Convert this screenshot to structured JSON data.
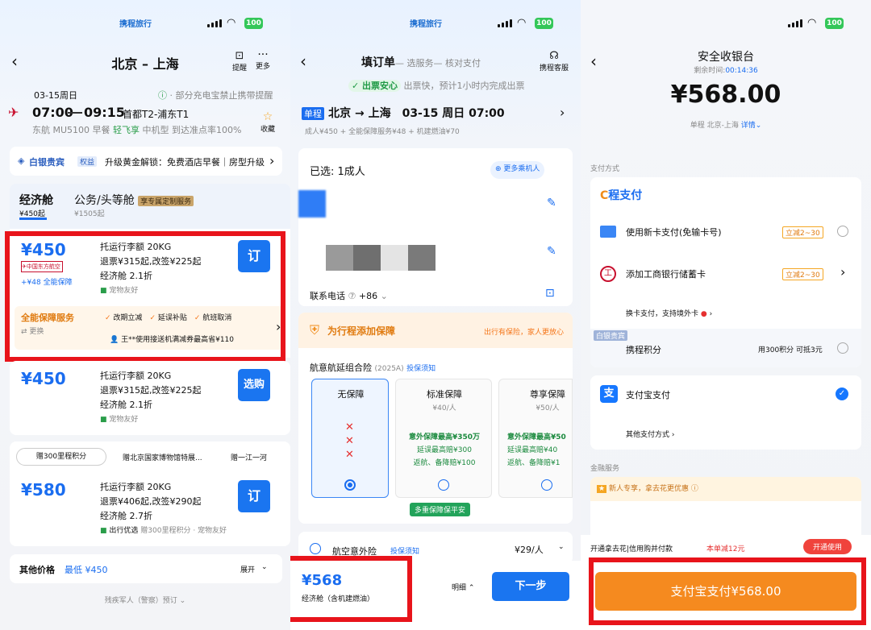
{
  "panel1": {
    "status": {
      "logo": "携程旅行",
      "battery": "100"
    },
    "header": {
      "title": "北京 – 上海",
      "icon1_label": "提醒",
      "icon2_label": "更多"
    },
    "flight": {
      "date": "03-15周日",
      "notice": "· 部分充电宝禁止携带提醒",
      "dep_time": "07:00",
      "arr_time": "09:15",
      "airports": "首都T2-浦东T1",
      "airline": "东航 MU5100",
      "meal": "早餐",
      "light": "轻飞享",
      "aircraft": "中机型",
      "ontime": "到达准点率100%",
      "fav": "收藏"
    },
    "member": {
      "level": "白银贵宾",
      "tag": "权益",
      "text": "升级黄金解锁：免费酒店早餐｜房型升级 等"
    },
    "tabs": [
      {
        "name": "经济舱",
        "price": "¥450起"
      },
      {
        "name": "公务/头等舱",
        "price": "¥1505起",
        "badge": "享专属定制服务"
      }
    ],
    "offers": [
      {
        "price": "¥450",
        "sub": "+¥48 全能保障",
        "l1": "托运行李额 20KG",
        "l2": "退票¥315起,改签¥225起",
        "l3": "经济舱 2.1折",
        "l4": "宠物友好",
        "btn": "订",
        "extra_title": "全能保障服务",
        "extra_change": "更换",
        "benefits": [
          "改期立减",
          "延误补贴",
          "航班取消"
        ],
        "promo": "王**使用接送机满减券最高省¥110"
      },
      {
        "price": "¥450",
        "l1": "托运行李额 20KG",
        "l2": "退票¥315起,改签¥225起",
        "l3": "经济舱 2.1折",
        "l4": "宠物友好",
        "btn": "选购"
      },
      {
        "price": "¥580",
        "l1": "托运行李额 20KG",
        "l2": "退票¥406起,改签¥290起",
        "l3": "经济舱 2.7折",
        "l4a": "出行优选",
        "l4b": "赠300里程积分 · 宠物友好",
        "btn": "订",
        "chips": [
          "赠300里程积分",
          "赠北京国家博物馆特展...",
          "赠一江一河"
        ]
      }
    ],
    "other": {
      "label": "其他价格",
      "lowest": "最低 ¥450",
      "expand": "展开"
    },
    "footer": "残疾军人（警察）预订"
  },
  "panel2": {
    "status": {
      "logo": "携程旅行",
      "battery": "100"
    },
    "header": {
      "title": "填订单",
      "step2": "— 选服务",
      "step3": "— 核对支付",
      "service": "携程客服"
    },
    "assure": {
      "badge": "出票安心",
      "text": "出票快，预计1小时内完成出票"
    },
    "trip": {
      "type": "单程",
      "route": "北京 → 上海　03-15 周日 07:00",
      "detail": "成人¥450 + 全能保障服务¥48 + 机建燃油¥70"
    },
    "passengers": {
      "selected": "已选: 1成人",
      "more": "更多乘机人",
      "phone_label": "联系电话",
      "phone_code": "+86"
    },
    "insurance": {
      "title": "为行程添加保障",
      "slogan": "出行有保险，家人更放心",
      "product": "航意航延组合险",
      "year": "(2025A)",
      "notice": "投保须知",
      "plans": [
        {
          "name": "无保障",
          "price": ""
        },
        {
          "name": "标准保障",
          "price": "¥40/人",
          "f1": "意外保障最高¥350万",
          "f2": "延误最高赔¥300",
          "f3": "返航、备降赔¥100"
        },
        {
          "name": "尊享保障",
          "price": "¥50/人",
          "f1": "意外保障最高¥50",
          "f2": "延误最高赔¥40",
          "f3": "返航、备降赔¥1"
        }
      ],
      "green": "多重保障保平安"
    },
    "accident": {
      "name": "航空意外险",
      "notice": "投保须知",
      "price": "¥29/人"
    },
    "bottom": {
      "price": "¥568",
      "sub": "经济舱（含机建燃油）",
      "detail": "明细",
      "next": "下一步"
    }
  },
  "panel3": {
    "status": {
      "battery": "100"
    },
    "header": {
      "title": "安全收银台",
      "remain_label": "剩余时间:",
      "remain": "00:14:36"
    },
    "amount": "¥568.00",
    "trip": {
      "text": "单程 北京-上海",
      "detail": "详情"
    },
    "section_pay": "支付方式",
    "brand": "程支付",
    "methods": [
      {
        "name": "使用新卡支付(免输卡号)",
        "tag": "立减2~30"
      },
      {
        "name": "添加工商银行储蓄卡",
        "tag": "立减2~30"
      }
    ],
    "change_card": "换卡支付，支持境外卡",
    "points": {
      "badge": "白银贵宾",
      "label": "携程积分",
      "text": "用300积分 可抵3元"
    },
    "alipay": {
      "name": "支付宝支付",
      "other": "其他支付方式"
    },
    "finance": "金融服务",
    "promo": "新人专享，拿去花更优惠",
    "banner": {
      "text": "开通拿去花|信用购并付款",
      "save": "本单减12元",
      "btn": "开通使用"
    },
    "pay_btn": "支付宝支付¥568.00"
  }
}
